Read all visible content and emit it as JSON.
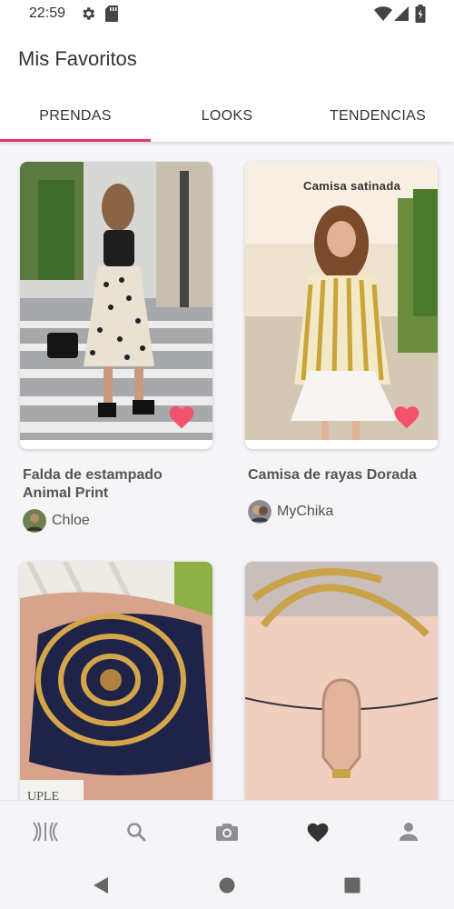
{
  "status_bar": {
    "time": "22:59",
    "icons": [
      "gear-icon",
      "sd-card-icon",
      "wifi-icon",
      "signal-icon",
      "battery-icon"
    ]
  },
  "app_bar": {
    "title": "Mis Favoritos"
  },
  "tabs": [
    {
      "label": "PRENDAS",
      "selected": true
    },
    {
      "label": "LOOKS",
      "selected": false
    },
    {
      "label": "TENDENCIAS",
      "selected": false
    }
  ],
  "colors": {
    "accent": "#e5307a",
    "heart": "#f2536a",
    "icon_gray": "#8e8e93",
    "icon_dark": "#333333"
  },
  "items": [
    {
      "title": "Falda de estampado Animal Print",
      "author": "Chloe",
      "favorite": true
    },
    {
      "title": "Camisa de rayas Dorada",
      "author": "MyChika",
      "favorite": true,
      "caption": "Camisa satinada",
      "carousel_pages": 4
    },
    {
      "title": "",
      "author": ""
    },
    {
      "title": "",
      "author": ""
    }
  ],
  "bottom_nav": [
    {
      "icon": "brand-logo-icon"
    },
    {
      "icon": "search-icon"
    },
    {
      "icon": "camera-icon"
    },
    {
      "icon": "heart-icon",
      "selected": true
    },
    {
      "icon": "profile-icon"
    }
  ],
  "system_nav": [
    "back-icon",
    "home-icon",
    "recents-icon"
  ]
}
